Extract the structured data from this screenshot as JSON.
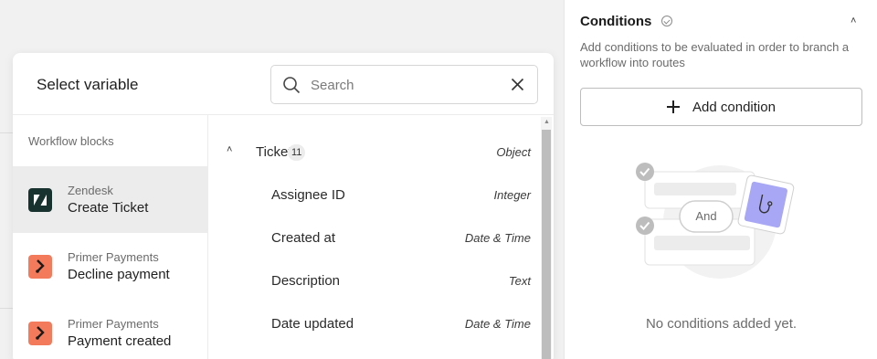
{
  "right_panel": {
    "title": "Conditions",
    "description": "Add conditions to be evaluated in order to branch a workflow into routes",
    "add_condition_label": "Add condition",
    "illustration_and_label": "And",
    "empty_text": "No conditions added yet."
  },
  "modal": {
    "title": "Select variable",
    "search_placeholder": "Search",
    "section_label": "Workflow blocks",
    "blocks": [
      {
        "provider": "Zendesk",
        "name": "Create Ticket",
        "icon": "zendesk-logo-icon",
        "selected": true
      },
      {
        "provider": "Primer Payments",
        "name": "Decline payment",
        "icon": "primer-logo-icon",
        "selected": false
      },
      {
        "provider": "Primer Payments",
        "name": "Payment created",
        "icon": "primer-logo-icon",
        "selected": false
      }
    ],
    "variables": {
      "group": {
        "name": "Ticket",
        "count": "11",
        "type": "Object"
      },
      "items": [
        {
          "name": "Assignee ID",
          "type": "Integer"
        },
        {
          "name": "Created at",
          "type": "Date & Time"
        },
        {
          "name": "Description",
          "type": "Text"
        },
        {
          "name": "Date updated",
          "type": "Date & Time"
        }
      ]
    }
  },
  "colors": {
    "zendesk": "#18322f",
    "primer": "#f37a5b",
    "selected_row": "#ececec",
    "illustration_accent": "#a7a7f5"
  }
}
